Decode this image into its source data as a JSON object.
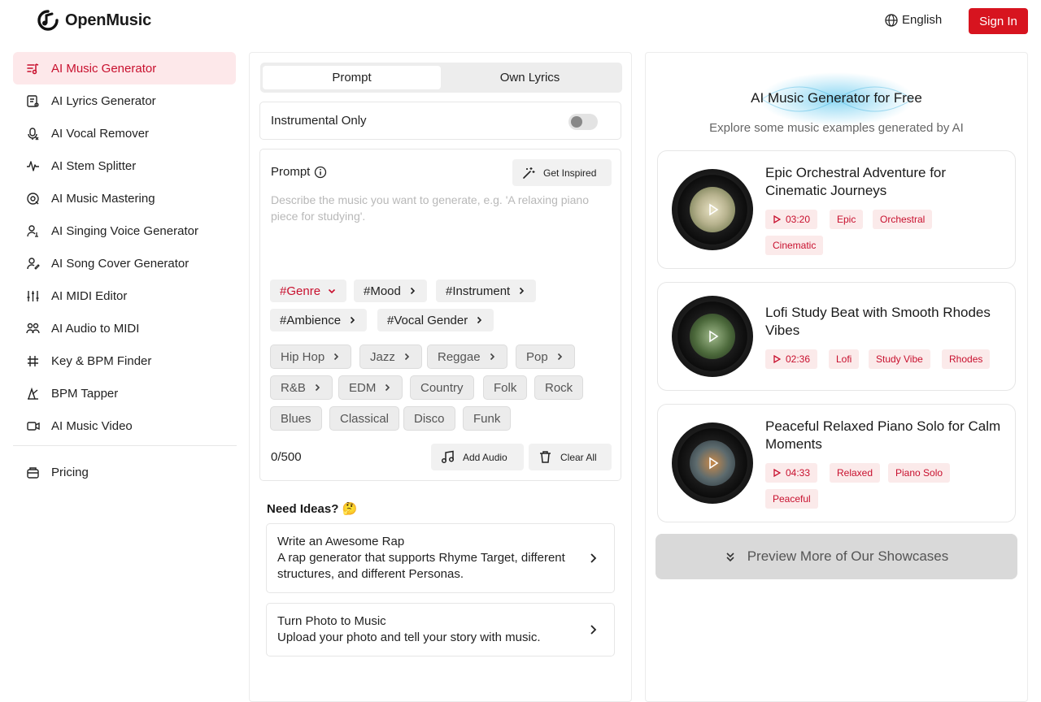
{
  "header": {
    "brand": "OpenMusic",
    "language": "English",
    "sign_in": "Sign In",
    "accent": "#d7141f"
  },
  "sidebar": {
    "items": [
      {
        "label": "AI Music Generator",
        "icon": "music-note-list-icon",
        "active": true
      },
      {
        "label": "AI Lyrics Generator",
        "icon": "lyrics-icon"
      },
      {
        "label": "AI Vocal Remover",
        "icon": "vocal-remover-icon"
      },
      {
        "label": "AI Stem Splitter",
        "icon": "waveform-icon"
      },
      {
        "label": "AI Music Mastering",
        "icon": "mastering-icon"
      },
      {
        "label": "AI Singing Voice Generator",
        "icon": "singer-icon"
      },
      {
        "label": "AI Song Cover Generator",
        "icon": "cover-icon"
      },
      {
        "label": "AI MIDI Editor",
        "icon": "sliders-icon"
      },
      {
        "label": "AI Audio to MIDI",
        "icon": "audio-to-midi-icon"
      },
      {
        "label": "Key & BPM Finder",
        "icon": "key-bpm-icon"
      },
      {
        "label": "BPM Tapper",
        "icon": "tap-icon"
      },
      {
        "label": "AI Music Video",
        "icon": "video-icon"
      }
    ],
    "pricing": "Pricing"
  },
  "generator": {
    "tabs": [
      "Prompt",
      "Own Lyrics"
    ],
    "instrumental_label": "Instrumental Only",
    "instrumental_on": false,
    "prompt_label": "Prompt",
    "get_inspired": "Get Inspired",
    "prompt_placeholder": "Describe the music you want to generate, e.g. 'A relaxing piano piece for studying'.",
    "categories": [
      "#Genre",
      "#Mood",
      "#Instrument",
      "#Ambience",
      "#Vocal Gender"
    ],
    "genres": [
      "Hip Hop",
      "Jazz",
      "Reggae",
      "Pop",
      "R&B",
      "EDM",
      "Country",
      "Folk",
      "Rock",
      "Blues",
      "Classical",
      "Disco",
      "Funk"
    ],
    "char_count": "0/500",
    "add_audio": "Add Audio",
    "clear_all": "Clear All"
  },
  "ideas": {
    "title": "Need Ideas? 🤔",
    "items": [
      {
        "title": "Write an Awesome Rap",
        "desc": "A rap generator that supports Rhyme Target, different structures, and different Personas."
      },
      {
        "title": "Turn Photo to Music",
        "desc": "Upload your photo and tell your story with music."
      }
    ]
  },
  "showcase": {
    "title": "AI Music Generator for Free",
    "subtitle": "Explore some music examples generated by AI",
    "cards": [
      {
        "title": "Epic Orchestral Adventure for Cinematic Journeys",
        "duration": "03:20",
        "tags": [
          "Epic",
          "Orchestral",
          "Cinematic"
        ]
      },
      {
        "title": "Lofi Study Beat with Smooth Rhodes Vibes",
        "duration": "02:36",
        "tags": [
          "Lofi",
          "Study Vibe",
          "Rhodes"
        ]
      },
      {
        "title": "Peaceful Relaxed Piano Solo for Calm Moments",
        "duration": "04:33",
        "tags": [
          "Relaxed",
          "Piano Solo",
          "Peaceful"
        ]
      }
    ],
    "more": "Preview More of Our Showcases"
  }
}
